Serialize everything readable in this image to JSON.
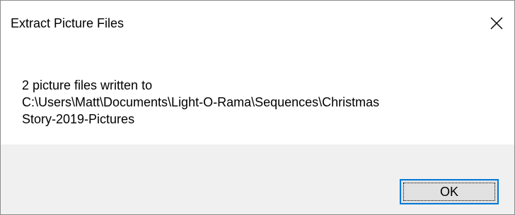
{
  "window": {
    "title": "Extract Picture Files",
    "close_icon": "close-icon"
  },
  "message": {
    "line1": "2 picture files written to",
    "line2": "C:\\Users\\Matt\\Documents\\Light-O-Rama\\Sequences\\Christmas",
    "line3": "Story-2019-Pictures"
  },
  "buttons": {
    "ok_label": "OK"
  },
  "colors": {
    "footer_bg": "#f0f0f0",
    "button_bg": "#e1e1e1",
    "button_focus_border": "#0078d7"
  }
}
